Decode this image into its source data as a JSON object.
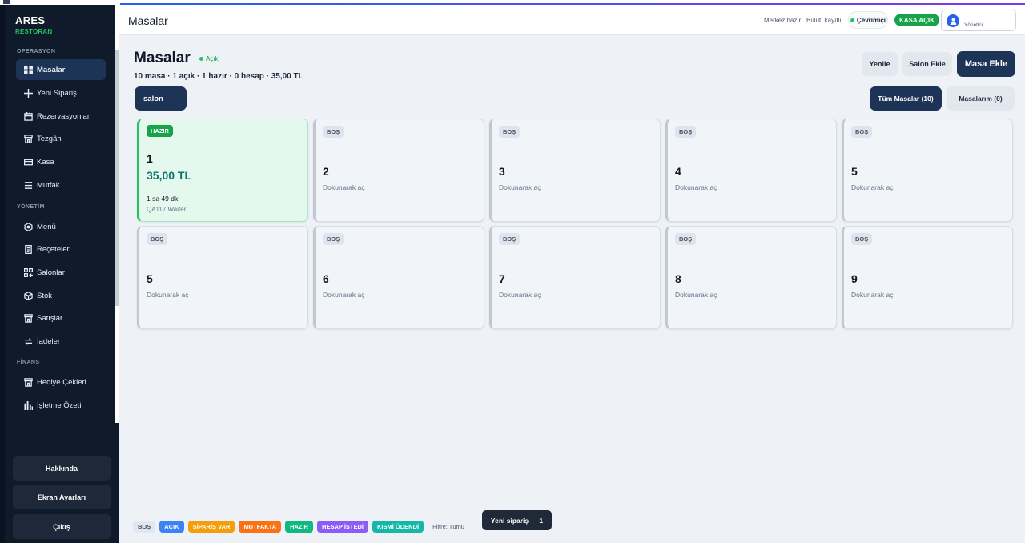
{
  "sidebar": {
    "brand": "ARES",
    "brand_sub": "RESTORAN",
    "sections": {
      "operations": "OPERASYON",
      "management": "YÖNETİM",
      "finance": "FİNANS"
    },
    "items": {
      "masalar": "Masalar",
      "yeni_siparis": "Yeni Sipariş",
      "rezervasyonlar": "Rezervasyonlar",
      "tezgah": "Tezgâh",
      "kasa": "Kasa",
      "mutfak": "Mutfak",
      "menu": "Menü",
      "receteler": "Reçeteler",
      "salonlar": "Salonlar",
      "stok": "Stok",
      "satislar": "Satışlar",
      "iadeler": "İadeler",
      "hediye_cekleri": "Hediye Çekleri",
      "isletme_ozeti": "İşletme Özeti"
    },
    "buttons": {
      "about": "Hakkında",
      "screen_settings": "Ekran Ayarları",
      "logout": "Çıkış"
    }
  },
  "header": {
    "title": "Masalar",
    "center_status": "Merkez hazır",
    "cloud_status": "Bulut: kayıtlı",
    "online": "Çevrimiçi",
    "register_status": "KASA AÇIK",
    "user_role": "Yönetici"
  },
  "main": {
    "title": "Masalar",
    "state": "Açık",
    "summary": "10 masa · 1 açık · 1 hazır · 0 hesap · 35,00 TL",
    "refresh": "Yenile",
    "add_salon": "Salon Ekle",
    "add_table": "Masa Ekle",
    "salon_tab": "salon",
    "filter_all": "Tüm Masalar (10)",
    "filter_mine": "Masalarım (0)"
  },
  "tables": [
    {
      "status": "HAZIR",
      "number": "1",
      "amount": "35,00 TL",
      "duration": "1 sa 49 dk",
      "waiter": "QA117 Waiter"
    },
    {
      "status": "BOŞ",
      "number": "2",
      "hint": "Dokunarak aç"
    },
    {
      "status": "BOŞ",
      "number": "3",
      "hint": "Dokunarak aç"
    },
    {
      "status": "BOŞ",
      "number": "4",
      "hint": "Dokunarak aç"
    },
    {
      "status": "BOŞ",
      "number": "5",
      "hint": "Dokunarak aç"
    },
    {
      "status": "BOŞ",
      "number": "5",
      "hint": "Dokunarak aç"
    },
    {
      "status": "BOŞ",
      "number": "6",
      "hint": "Dokunarak aç"
    },
    {
      "status": "BOŞ",
      "number": "7",
      "hint": "Dokunarak aç"
    },
    {
      "status": "BOŞ",
      "number": "8",
      "hint": "Dokunarak aç"
    },
    {
      "status": "BOŞ",
      "number": "9",
      "hint": "Dokunarak aç"
    }
  ],
  "legend": {
    "bos": "BOŞ",
    "acik": "AÇIK",
    "siparis_var": "SİPARİŞ VAR",
    "mutfakta": "MUTFAKTA",
    "hazir": "HAZIR",
    "hesap_istedi": "HESAP İSTEDİ",
    "kismi_odendi": "KISMİ ÖDENDİ",
    "filter": "Filtre: Tümü"
  },
  "legend_colors": {
    "bos": "#e2e8f0",
    "acik": "#3b82f6",
    "siparis_var": "#f59e0b",
    "mutfakta": "#f97316",
    "hazir": "#10b981",
    "hesap_istedi": "#8b5cf6",
    "kismi_odendi": "#14b8a6"
  },
  "toast": "Yeni sipariş — 1",
  "icons": {
    "masalar": "grid-icon",
    "yeni_siparis": "plus-icon",
    "rezervasyonlar": "calendar-icon",
    "tezgah": "store-icon",
    "kasa": "cash-icon",
    "mutfak": "menu-lines-icon",
    "menu": "hexagon-icon",
    "receteler": "document-icon",
    "salonlar": "grid-plus-icon",
    "stok": "box-icon",
    "satislar": "store-icon",
    "iadeler": "return-icon",
    "hediye_cekleri": "gift-icon",
    "isletme_ozeti": "bar-chart-icon",
    "user": "user-icon"
  }
}
